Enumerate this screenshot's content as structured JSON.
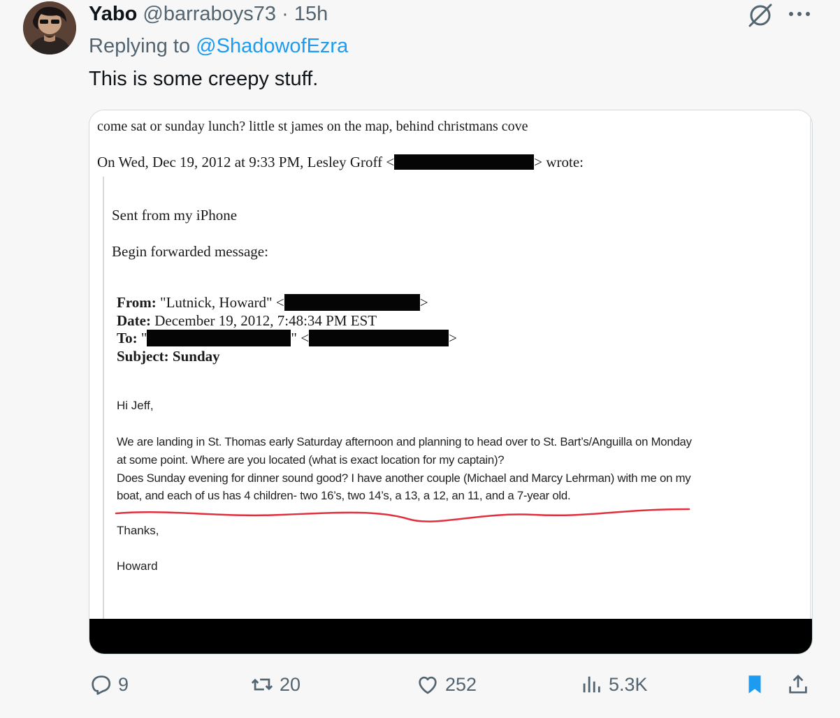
{
  "tweet": {
    "display_name": "Yabo",
    "handle": "@barraboys73",
    "separator": "·",
    "time": "15h",
    "reply_prefix": "Replying to",
    "reply_to": "@ShadowofEzra",
    "text": "This is some creepy stuff."
  },
  "document": {
    "line1": "come sat or sunday lunch?  little st james on the map,  behind christmans cove",
    "quoted_prefix": "On Wed, Dec 19, 2012 at 9:33 PM, Lesley Groff <",
    "quoted_suffix": "> wrote:",
    "sent_from": "Sent from my iPhone",
    "begin_forwarded": "Begin forwarded message:",
    "from_label": "From:",
    "from_value": " \"Lutnick, Howard\" <",
    "from_close": ">",
    "date_label": "Date:",
    "date_value": " December 19, 2012, 7:48:34 PM EST",
    "to_label": "To:",
    "to_open_quote": " \"",
    "to_mid": "\" <",
    "to_close": ">",
    "subject_label": "Subject:",
    "subject_value": " Sunday",
    "greeting": "Hi Jeff,",
    "body_line1": "We are landing in St. Thomas early Saturday afternoon and planning to head over to St. Bart’s/Anguilla on Monday",
    "body_line2": "at some point.  Where are you located (what is exact location for my captain)?",
    "body_line3": "Does Sunday evening for dinner sound good?  I have another couple (Michael and Marcy Lehrman) with me on my",
    "body_line4": "boat, and each of us has 4 children- two 16’s, two 14’s, a 13, a 12, an 11, and a 7-year old.",
    "thanks": "Thanks,",
    "signature": "Howard"
  },
  "actions": {
    "replies": "9",
    "reposts": "20",
    "likes": "252",
    "views": "5.3K"
  },
  "colors": {
    "accent": "#1d9bf0",
    "secondary_text": "#536471",
    "underline_annotation": "#e0303e"
  },
  "icons": [
    "grok-icon",
    "more-icon",
    "reply-icon",
    "repost-icon",
    "like-icon",
    "views-icon",
    "bookmark-icon",
    "share-icon"
  ]
}
